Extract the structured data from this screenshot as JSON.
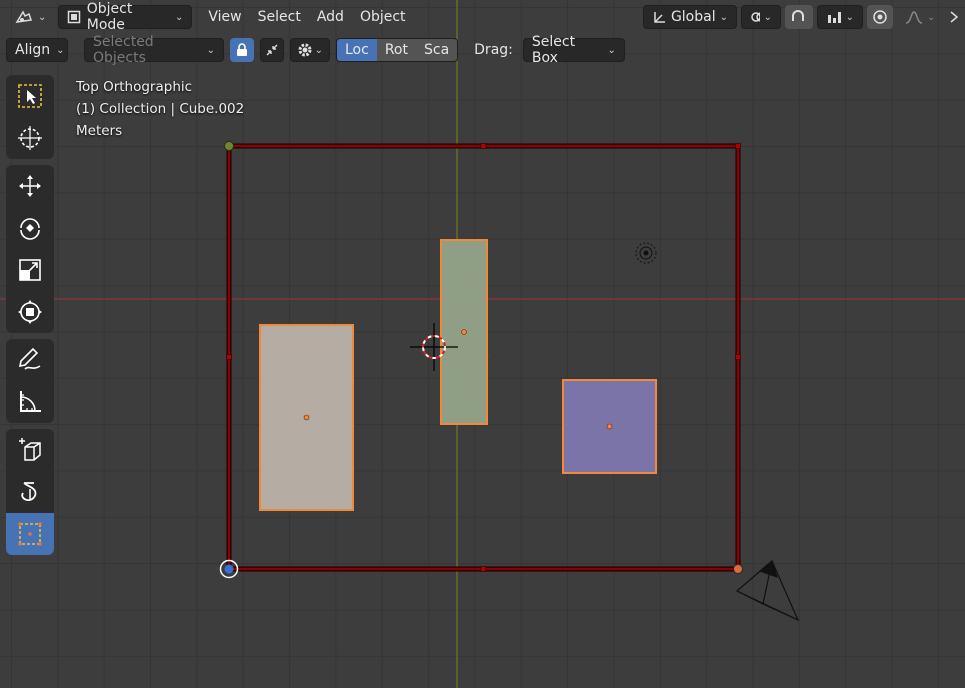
{
  "header": {
    "editor_type_icon": "editor-type-icon",
    "mode_label": "Object Mode",
    "menus": [
      "View",
      "Select",
      "Add",
      "Object"
    ],
    "transform_orientation": "Global"
  },
  "tool_settings": {
    "align_label": "Align",
    "selected_objects_label": "Selected Objects",
    "segments": [
      "Loc",
      "Rot",
      "Sca"
    ],
    "active_segment": "Loc",
    "drag_label": "Drag:",
    "drag_value": "Select Box"
  },
  "toolbar": {
    "tools": [
      "select-box",
      "cursor",
      "move",
      "rotate",
      "scale",
      "transform",
      "annotate",
      "measure",
      "add-cube",
      "spin",
      "box-bevel"
    ],
    "active_tool": "box-bevel"
  },
  "overlay": {
    "view_name": "Top Orthographic",
    "collection_info": "(1) Collection | Cube.002",
    "units": "Meters"
  },
  "scene": {
    "colors": {
      "accent": "#4772b3",
      "selection_outline": "#f08a3a",
      "bounds_red": "#8b0000",
      "x_axis": "#8a3a3a",
      "y_axis": "#6d7a24",
      "cube_beige": "#b5aca4",
      "cube_green": "#919e86",
      "cube_purple": "#7b74a8"
    }
  }
}
